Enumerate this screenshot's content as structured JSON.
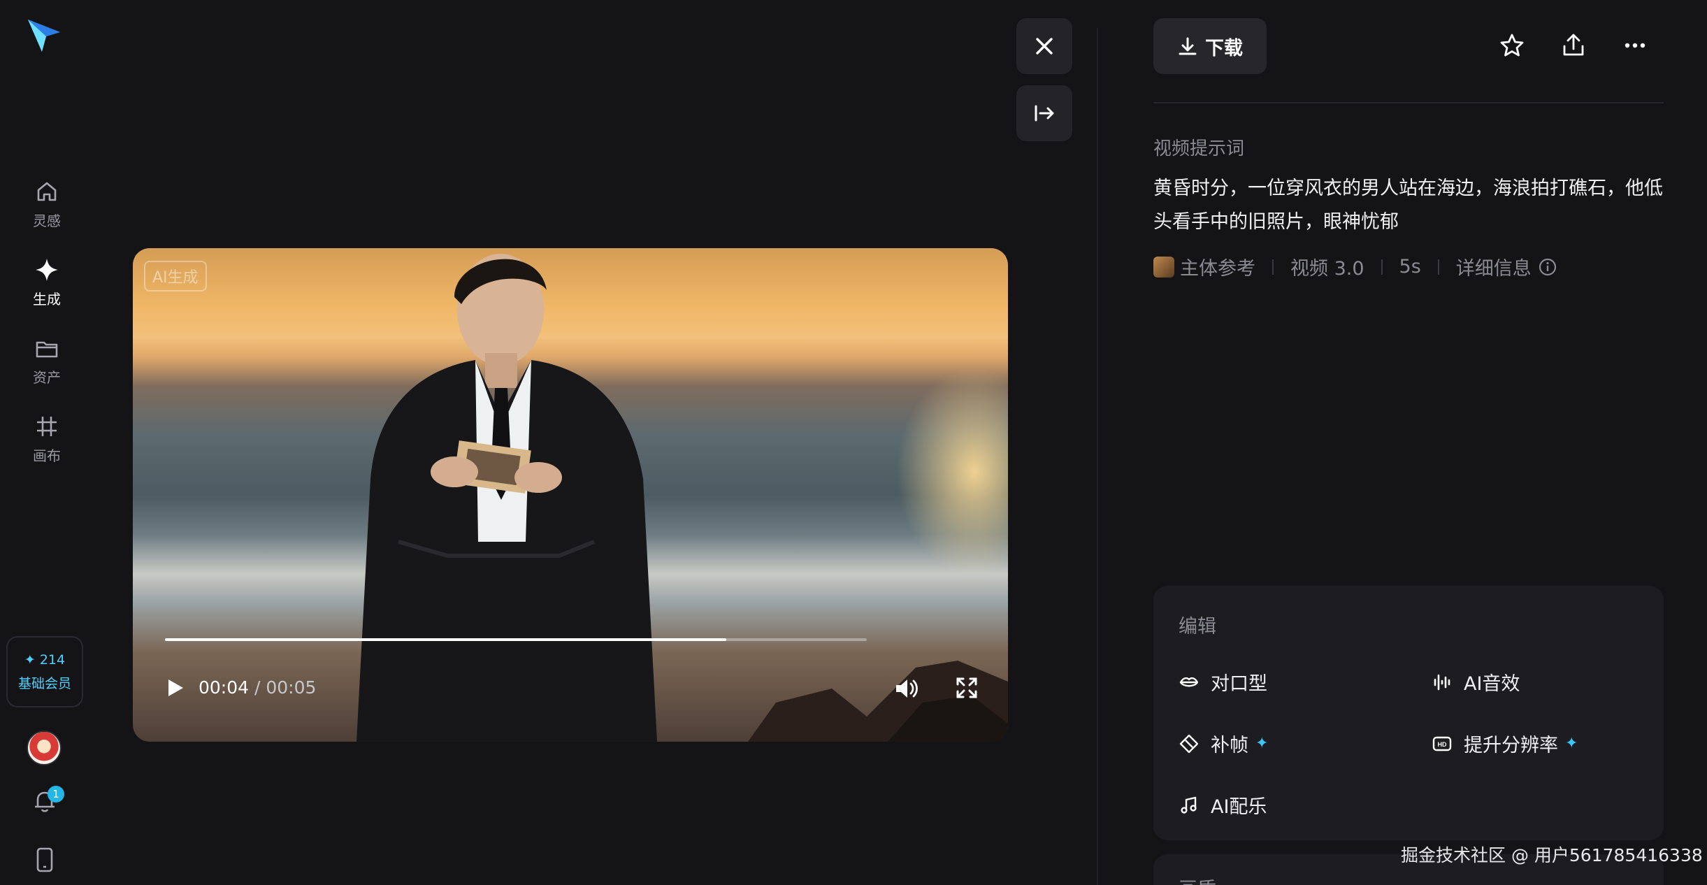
{
  "nav": {
    "items": [
      {
        "label": "灵感",
        "icon": "home-icon"
      },
      {
        "label": "生成",
        "icon": "sparkle-icon",
        "active": true
      },
      {
        "label": "资产",
        "icon": "folder-icon"
      },
      {
        "label": "画布",
        "icon": "canvas-icon"
      }
    ],
    "member": {
      "points": "214",
      "level": "基础会员"
    },
    "notifications": "1"
  },
  "video": {
    "ai_tag": "AI生成",
    "current_time": "00:04",
    "duration": "/ 00:05",
    "progress": 0.8
  },
  "panel": {
    "download_label": "下载",
    "prompt_label": "视频提示词",
    "prompt_text": "黄昏时分，一位穿风衣的男人站在海边，海浪拍打礁石，他低头看手中的旧照片，眼神忧郁",
    "meta": {
      "subject_ref": "主体参考",
      "model": "视频 3.0",
      "duration": "5s",
      "details": "详细信息"
    },
    "edit": {
      "title": "编辑",
      "tools": {
        "lip_sync": "对口型",
        "ai_sfx": "AI音效",
        "frame_interp": "补帧",
        "upscale": "提升分辨率",
        "ai_music": "AI配乐"
      }
    },
    "next_section": "画质"
  },
  "watermark": "掘金技术社区 @ 用户561785416338",
  "colors": {
    "accent": "#36c8ff",
    "background": "#141417",
    "panel": "#1d1d21"
  }
}
